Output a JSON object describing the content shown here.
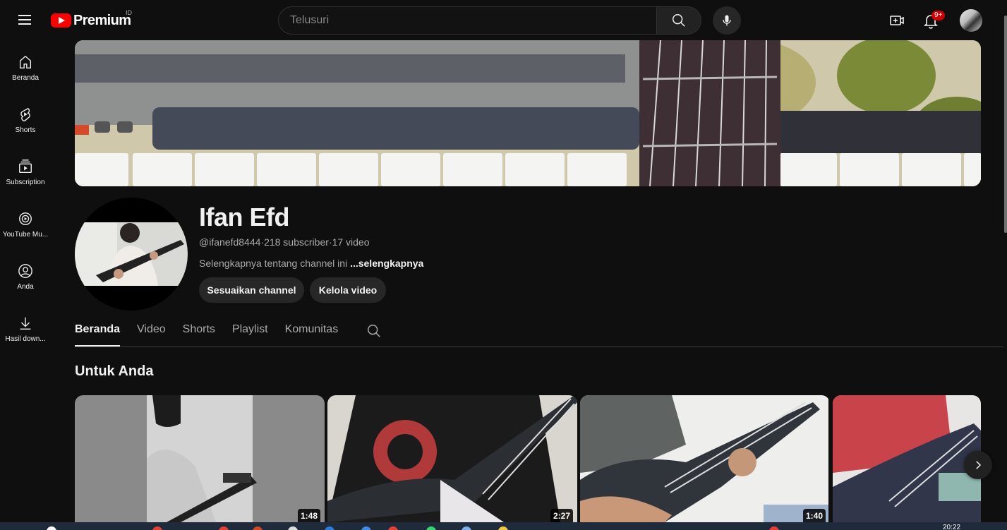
{
  "header": {
    "logo_text": "Premium",
    "country_code": "ID",
    "search_placeholder": "Telusuri",
    "notification_count": "9+"
  },
  "guide": {
    "items": [
      {
        "label": "Beranda",
        "icon": "home-icon"
      },
      {
        "label": "Shorts",
        "icon": "shorts-icon"
      },
      {
        "label": "Subscription",
        "icon": "subscriptions-icon"
      },
      {
        "label": "YouTube Mu...",
        "icon": "youtube-music-icon"
      },
      {
        "label": "Anda",
        "icon": "account-icon"
      },
      {
        "label": "Hasil down...",
        "icon": "download-icon"
      }
    ]
  },
  "channel": {
    "name": "Ifan Efd",
    "handle": "@ifanefd8444",
    "subscribers": "218 subscriber",
    "videos": "17 video",
    "separator": " · ",
    "about_text": "Selengkapnya tentang channel ini ",
    "about_more": "...selengkapnya",
    "customize_label": "Sesuaikan channel",
    "manage_label": "Kelola video"
  },
  "tabs": [
    {
      "label": "Beranda",
      "active": true
    },
    {
      "label": "Video",
      "active": false
    },
    {
      "label": "Shorts",
      "active": false
    },
    {
      "label": "Playlist",
      "active": false
    },
    {
      "label": "Komunitas",
      "active": false
    }
  ],
  "section": {
    "title": "Untuk Anda"
  },
  "videos": [
    {
      "duration": "1:48"
    },
    {
      "duration": "2:27"
    },
    {
      "duration": "1:40"
    },
    {
      "duration": ""
    }
  ],
  "taskbar": {
    "clock": "20:22"
  },
  "colors": {
    "background": "#0f0f0f",
    "brand_red": "#ff0000",
    "pill_bg": "#272727",
    "badge_red": "#cc0000"
  }
}
